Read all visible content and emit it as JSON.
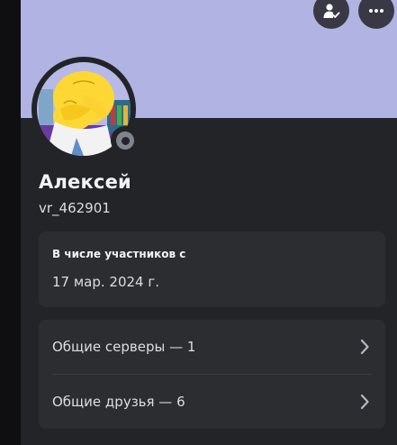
{
  "header": {
    "add_friend_icon": "person-check-icon",
    "more_icon": "more-horizontal-icon",
    "banner_color": "#b1b3e3"
  },
  "profile": {
    "display_name": "Алексей",
    "username": "vr_462901",
    "status": "offline"
  },
  "member_since": {
    "title": "В числе участников с",
    "date": "17 мар. 2024 г."
  },
  "mutual": {
    "servers_label": "Общие серверы — 1",
    "friends_label": "Общие друзья — 6"
  },
  "colors": {
    "panel": "#232428",
    "card": "#2b2d31",
    "text_primary": "#f2f3f5",
    "text_secondary": "#dbdee1"
  }
}
